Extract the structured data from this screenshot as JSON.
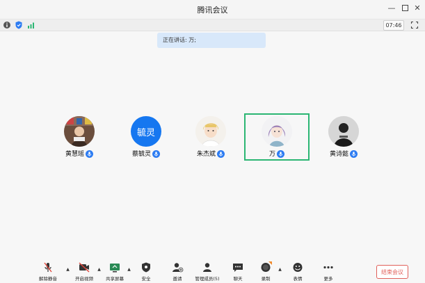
{
  "window": {
    "title": "腾讯会议"
  },
  "status": {
    "time": "07:46"
  },
  "speaking": {
    "text": "正在讲话: 万;"
  },
  "participants": [
    {
      "name": "黄慧瑶"
    },
    {
      "name": "蔡毓灵",
      "avatar_text": "毓灵"
    },
    {
      "name": "朱杰斌"
    },
    {
      "name": "万"
    },
    {
      "name": "黄诗懿"
    }
  ],
  "toolbar": {
    "unmute": "解除静音",
    "video": "开启视频",
    "share": "共享屏幕",
    "security": "安全",
    "invite": "邀请",
    "members": "管理成员(5)",
    "chat": "聊天",
    "record": "录制",
    "reaction": "表情",
    "more": "更多",
    "end": "结束会议"
  },
  "colors": {
    "accent": "#2d7cf2",
    "speaker_border": "#2bb673",
    "end": "#e0605a"
  }
}
